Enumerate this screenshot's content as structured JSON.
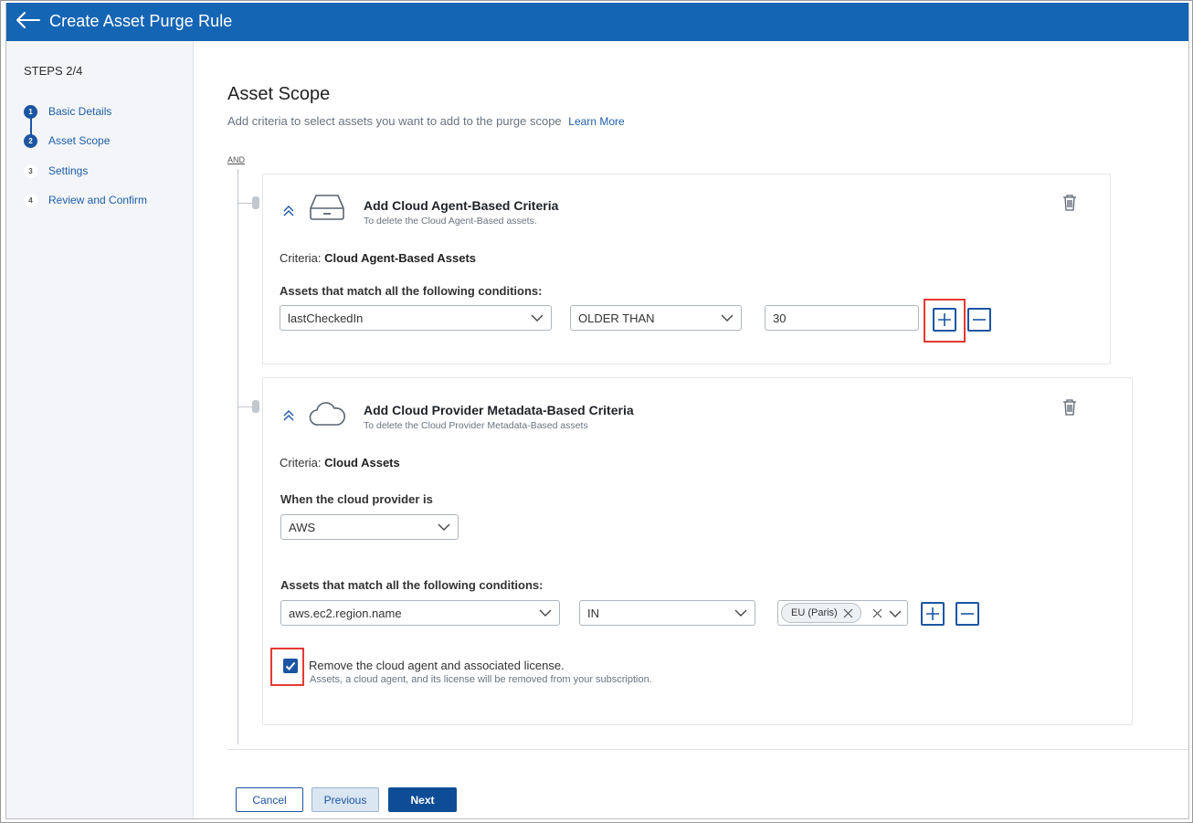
{
  "header": {
    "title": "Create Asset Purge Rule",
    "back_icon": "arrow-left-icon"
  },
  "sidebar": {
    "steps_count": "STEPS 2/4",
    "steps": [
      {
        "number": "1",
        "label": "Basic Details",
        "state": "done"
      },
      {
        "number": "2",
        "label": "Asset Scope",
        "state": "active"
      },
      {
        "number": "3",
        "label": "Settings",
        "state": "pending"
      },
      {
        "number": "4",
        "label": "Review and Confirm",
        "state": "pending"
      }
    ]
  },
  "main": {
    "title": "Asset Scope",
    "subtitle": "Add criteria to select assets you want to add to the purge scope",
    "learn_more": "Learn More",
    "operator": "AND",
    "card1": {
      "title": "Add Cloud Agent-Based Criteria",
      "description": "To delete the Cloud Agent-Based assets.",
      "criteria_label": "Criteria:",
      "criteria_value": "Cloud Agent-Based Assets",
      "conditions_label": "Assets that match all the following conditions:",
      "field": "lastCheckedIn",
      "operator": "OLDER THAN",
      "value": "30"
    },
    "card2": {
      "title": "Add Cloud Provider Metadata-Based Criteria",
      "description": "To delete the Cloud Provider Metadata-Based assets",
      "criteria_label": "Criteria:",
      "criteria_value": "Cloud Assets",
      "provider_label": "When the cloud provider is",
      "provider": "AWS",
      "conditions_label": "Assets that match all the following conditions:",
      "field": "aws.ec2.region.name",
      "operator": "IN",
      "chip": "EU (Paris)",
      "checkbox_label": "Remove the cloud agent and associated license.",
      "checkbox_sub": "Assets, a cloud agent, and its license will be removed from your subscription.",
      "checkbox_checked": true
    }
  },
  "footer": {
    "cancel": "Cancel",
    "previous": "Previous",
    "next": "Next"
  },
  "colors": {
    "brand": "#1565b5",
    "accent": "#1b55a3",
    "highlight": "#e53935"
  }
}
